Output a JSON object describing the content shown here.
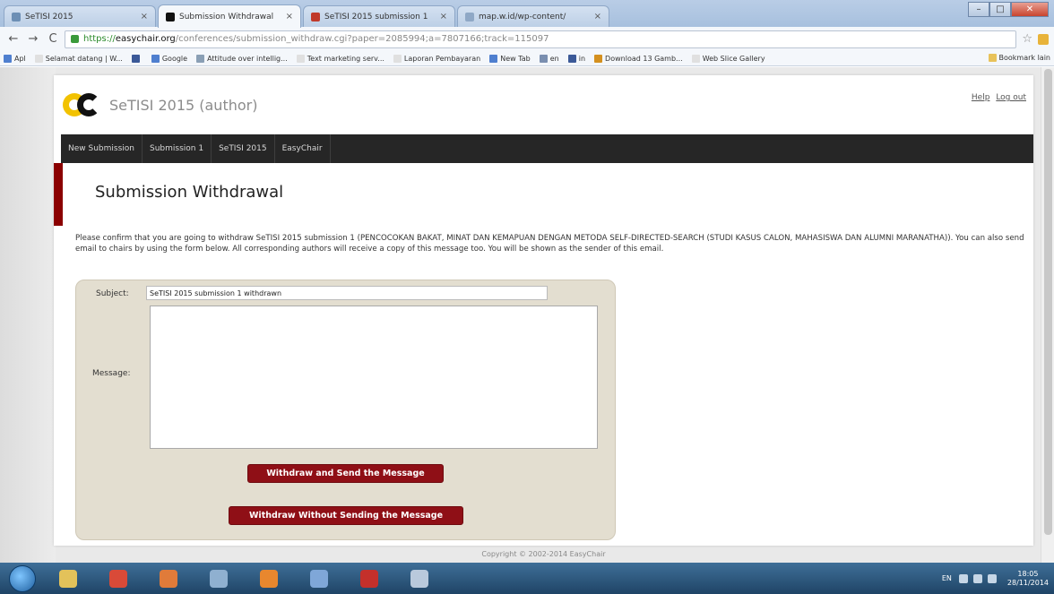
{
  "browser": {
    "tabs": [
      {
        "label": "SeTISI 2015",
        "color": "#6d8fb5",
        "active": false
      },
      {
        "label": "Submission Withdrawal",
        "color": "#111111",
        "active": true
      },
      {
        "label": "SeTISI 2015 submission 1",
        "color": "#c0392b",
        "active": false
      },
      {
        "label": "map.w.id/wp-content/",
        "color": "#8fa8c6",
        "active": false
      }
    ],
    "url": {
      "scheme": "https://",
      "host": "easychair.org",
      "path": "/conferences/submission_withdraw.cgi?paper=2085994;a=7807166;track=115097"
    },
    "bookmarks": [
      {
        "label": "Apl",
        "color": "#4f7fcf"
      },
      {
        "label": "Selamat datang | W...",
        "color": "#e0e0e0"
      },
      {
        "label": "",
        "color": "#3b5998"
      },
      {
        "label": "Google",
        "color": "#4f7fcf"
      },
      {
        "label": "Attitude over intellig...",
        "color": "#8a9fb5"
      },
      {
        "label": "Text marketing serv...",
        "color": "#e0e0e0"
      },
      {
        "label": "Laporan Pembayaran",
        "color": "#e0e0e0"
      },
      {
        "label": "New Tab",
        "color": "#4f7fcf"
      },
      {
        "label": "en",
        "color": "#7a8fb0"
      },
      {
        "label": "in",
        "color": "#3b5998"
      },
      {
        "label": "Download 13 Gamb...",
        "color": "#d4901f"
      },
      {
        "label": "Web Slice Gallery",
        "color": "#e0e0e0"
      }
    ],
    "other_bookmarks": "Bookmark lain"
  },
  "site": {
    "logo_text": "SeTISI 2015 (author)",
    "help": "Help",
    "logout": "Log out",
    "menu": [
      "New Submission",
      "Submission 1",
      "SeTISI 2015",
      "EasyChair"
    ],
    "page_title": "Submission Withdrawal",
    "intro": "Please confirm that you are going to withdraw SeTISI 2015 submission 1 (PENCOCOKAN BAKAT, MINAT DAN KEMAPUAN DENGAN METODA SELF-DIRECTED-SEARCH (STUDI KASUS CALON, MAHASISWA DAN ALUMNI MARANATHA)). You can also send email to chairs by using the form below. All corresponding authors will receive a copy of this message too. You will be shown as the sender of this email.",
    "form": {
      "subject_label": "Subject:",
      "subject_value": "SeTISI 2015 submission 1 withdrawn",
      "message_label": "Message:",
      "message_value": "",
      "btn_send": "Withdraw and Send the Message",
      "btn_nosend": "Withdraw Without Sending the Message"
    },
    "footer": "Copyright © 2002-2014 EasyChair"
  },
  "taskbar": {
    "apps": [
      {
        "name": "explorer",
        "color": "#e3c25a"
      },
      {
        "name": "chrome",
        "color": "#d94a38"
      },
      {
        "name": "media",
        "color": "#e07b3a"
      },
      {
        "name": "tools",
        "color": "#8fb0d0"
      },
      {
        "name": "firefox",
        "color": "#e8872e"
      },
      {
        "name": "network",
        "color": "#7fa7d8"
      },
      {
        "name": "acrobat",
        "color": "#c4302b"
      },
      {
        "name": "calculator",
        "color": "#b9c9dc"
      }
    ],
    "lang": "EN",
    "time": "18:05",
    "date": "28/11/2014"
  },
  "colors": {
    "accent_red": "#8f0f16",
    "menu_bg": "#262626",
    "form_bg": "#e3ded0"
  }
}
